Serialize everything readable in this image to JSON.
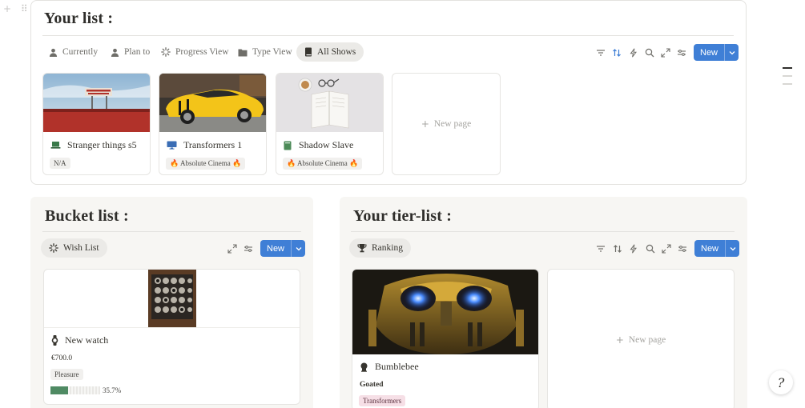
{
  "your_list": {
    "title": "Your list :",
    "tabs": [
      {
        "label": "Currently",
        "icon": "person-icon"
      },
      {
        "label": "Plan to",
        "icon": "person-icon"
      },
      {
        "label": "Progress View",
        "icon": "loader-icon"
      },
      {
        "label": "Type View",
        "icon": "folder-icon"
      },
      {
        "label": "All Shows",
        "icon": "book-icon",
        "active": true
      }
    ],
    "new_label": "New",
    "cards": [
      {
        "title": "Stranger things s5",
        "icon": "laptop-icon",
        "tag": "N/A"
      },
      {
        "title": "Transformers 1",
        "icon": "monitor-icon",
        "tag": "🔥 Absolute Cinema 🔥"
      },
      {
        "title": "Shadow Slave",
        "icon": "book-green-icon",
        "tag": "🔥 Absolute Cinema 🔥"
      }
    ],
    "new_page_label": "New page"
  },
  "bucket_list": {
    "title": "Bucket list :",
    "tab": {
      "label": "Wish List",
      "icon": "loader-icon"
    },
    "new_label": "New",
    "card": {
      "title": "New watch",
      "icon": "watch-icon",
      "price": "€700.0",
      "tag": "Pleasure",
      "progress": 0.357,
      "progress_text": "35.7%"
    }
  },
  "tier_list": {
    "title": "Your tier-list :",
    "tab": {
      "label": "Ranking",
      "icon": "trophy-icon"
    },
    "new_label": "New",
    "card": {
      "title": "Bumblebee",
      "icon": "robot-head-icon",
      "rank": "Goated",
      "tag": "Transformers"
    },
    "new_page_label": "New page"
  },
  "colors": {
    "accent": "#3f7fd6",
    "progress_fill": "#4f8a63",
    "tag_pink": "#f6dfe6"
  },
  "help_glyph": "?"
}
